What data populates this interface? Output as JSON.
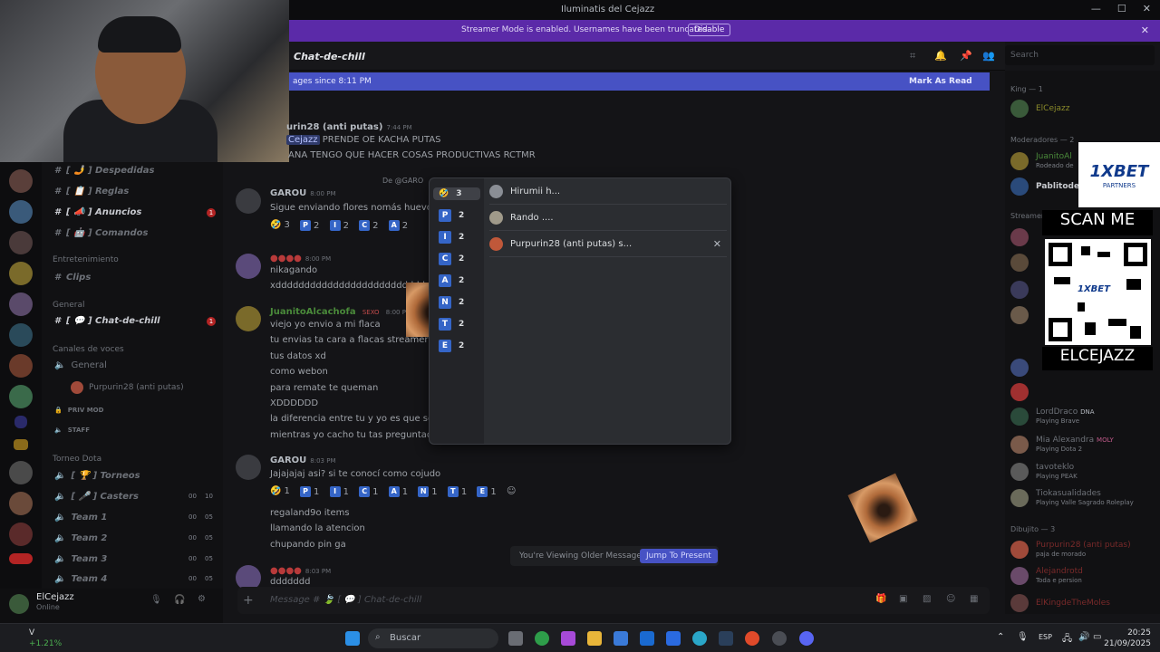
{
  "window": {
    "title": "Iluminatis del Cejazz",
    "minimize": "—",
    "maximize": "☐",
    "close": "✕"
  },
  "banner": {
    "text": "Streamer Mode is enabled. Usernames have been truncated.",
    "disable_label": "Disable",
    "close": "✕"
  },
  "channel": {
    "name": "Chat-de-chill",
    "search_placeholder": "Search"
  },
  "new_messages": {
    "text": "ages since 8:11 PM",
    "mark_read": "Mark As Read"
  },
  "sidebar": {
    "channels": [
      {
        "label": "[ 🤳 ] Despedidas"
      },
      {
        "label": "[ 📋 ] Reglas"
      },
      {
        "label": "[ 📣 ] Anuncios"
      },
      {
        "label": "[ 🤖 ] Comandos"
      }
    ],
    "cat_entretenimiento": "Entretenimiento",
    "clips": "Clips",
    "cat_general": "General",
    "chat_de_chill": "[ 💬 ] Chat-de-chill",
    "cat_voz": "Canales de voces",
    "voice_general": "General",
    "voice_user": "Purpurin28 (anti putas)",
    "priv_mod": "PRIV MOD",
    "staff": "STAFF",
    "cat_torneo": "Torneo Dota",
    "torneos": "[ 🏆 ] Torneos",
    "casters": "[ 🎤 ] Casters",
    "teams": [
      {
        "label": "Team 1",
        "count": "00",
        "max": "05"
      },
      {
        "label": "Team 2",
        "count": "00",
        "max": "05"
      },
      {
        "label": "Team 3",
        "count": "00",
        "max": "05"
      },
      {
        "label": "Team 4",
        "count": "00",
        "max": "05"
      }
    ],
    "casters_count": "00",
    "casters_max": "10",
    "badge": "1"
  },
  "user": {
    "name": "ElCejazz",
    "status": "Online"
  },
  "messages": {
    "m1_author": "urin28 (anti putas)",
    "m1_time": "7:44 PM",
    "m1_line1": "PRENDE OE KACHA PUTAS",
    "m1_mention": "Cejazz",
    "m1_line2": "ANA TENGO QUE HACER COSAS PRODUCTIVAS RCTMR",
    "reply_prefix": "De @GARO",
    "garo1_author": "GAROU",
    "garo1_time": "8:00 PM",
    "garo1_line": "Sigue enviando flores nomás huevona",
    "r_author": "8:00 PM",
    "nika1": "nikagando",
    "nika2": "xdddddddddddddddddddddddddddddd",
    "juan_author": "JuanitoAlcachofa",
    "juan_tag": "SEXO",
    "juan_time": "8:00 PM",
    "juan_lines": [
      "viejo yo envio a mi flaca",
      "tu envias ta cara a flacas streamers",
      "tus datos xd",
      "como webon",
      "para remate te queman",
      "XDDDDDD",
      "la diferencia entre tu y yo es que solo e",
      "mientras yo cacho tu tas preguntado q"
    ],
    "garo2_author": "GAROU",
    "garo2_time": "8:03 PM",
    "garo2_line": "Jajajajaj asi? si te conocí como cojudo",
    "last_lines": [
      "regaland9o items",
      "llamando la atencion",
      "chupando pin ga"
    ],
    "last_time": "8:03 PM",
    "last_line": "ddddddd"
  },
  "reactions_row1": [
    {
      "emoji": "🤣",
      "count": "3"
    },
    {
      "emoji": "P",
      "count": "2"
    },
    {
      "emoji": "I",
      "count": "2"
    },
    {
      "emoji": "C",
      "count": "2"
    },
    {
      "emoji": "A",
      "count": "2"
    }
  ],
  "reactions_row2": [
    {
      "emoji": "🤣",
      "count": "1"
    },
    {
      "emoji": "P",
      "count": "1"
    },
    {
      "emoji": "I",
      "count": "1"
    },
    {
      "emoji": "C",
      "count": "1"
    },
    {
      "emoji": "A",
      "count": "1"
    },
    {
      "emoji": "N",
      "count": "1"
    },
    {
      "emoji": "T",
      "count": "1"
    },
    {
      "emoji": "E",
      "count": "1"
    }
  ],
  "popup": {
    "emojis": [
      {
        "emoji": "🤣",
        "count": "3"
      },
      {
        "emoji": "P",
        "count": "2"
      },
      {
        "emoji": "I",
        "count": "2"
      },
      {
        "emoji": "C",
        "count": "2"
      },
      {
        "emoji": "A",
        "count": "2"
      },
      {
        "emoji": "N",
        "count": "2"
      },
      {
        "emoji": "T",
        "count": "2"
      },
      {
        "emoji": "E",
        "count": "2"
      }
    ],
    "users": [
      "Hirumii h...",
      "Rando ....",
      "Purpurin28 (anti putas) s..."
    ],
    "close": "✕"
  },
  "older": {
    "label": "You're Viewing Older Messages",
    "jump": "Jump To Present"
  },
  "composer": {
    "placeholder": "Message # 🍃 [ 💬 ] Chat-de-chill"
  },
  "members": {
    "king_head": "King — 1",
    "king": "ElCejazz",
    "mods_head": "Moderadores — 2",
    "mod1": "JuanitoAl",
    "mod1_sub": "Rodeado de ",
    "mod2": "Pablitode",
    "streamers_head": "Streamer",
    "users": [
      {
        "name": "LordDraco",
        "tag": "DNA",
        "sub": "Playing Brave"
      },
      {
        "name": "Mia Alexandra",
        "tag": "MOLY",
        "sub": "Playing Dota 2"
      },
      {
        "name": "tavoteklo",
        "tag": "",
        "sub": "Playing PEAK"
      },
      {
        "name": "Tiokasualidades",
        "tag": "",
        "sub": "Playing Valle Sagrado Roleplay"
      }
    ],
    "dibujito_head": "Dibujito — 3",
    "dib": [
      {
        "name": "Purpurin28 (anti putas)",
        "sub": "paja de morado"
      },
      {
        "name": "Alejandrotd",
        "sub": "Toda e persion"
      },
      {
        "name": "ElKingdeTheMoles",
        "sub": ""
      }
    ]
  },
  "ad": {
    "brand": "1XBET",
    "sub": "PARTNERS",
    "scan": "SCAN ME",
    "handle": "ELCEJAZZ",
    "qr_text": "1XBET"
  },
  "taskbar": {
    "search": "Buscar",
    "stock_symbol": "V",
    "stock_change": "+1.21%",
    "lang": "ESP",
    "time": "20:25",
    "date": "21/09/2025"
  }
}
